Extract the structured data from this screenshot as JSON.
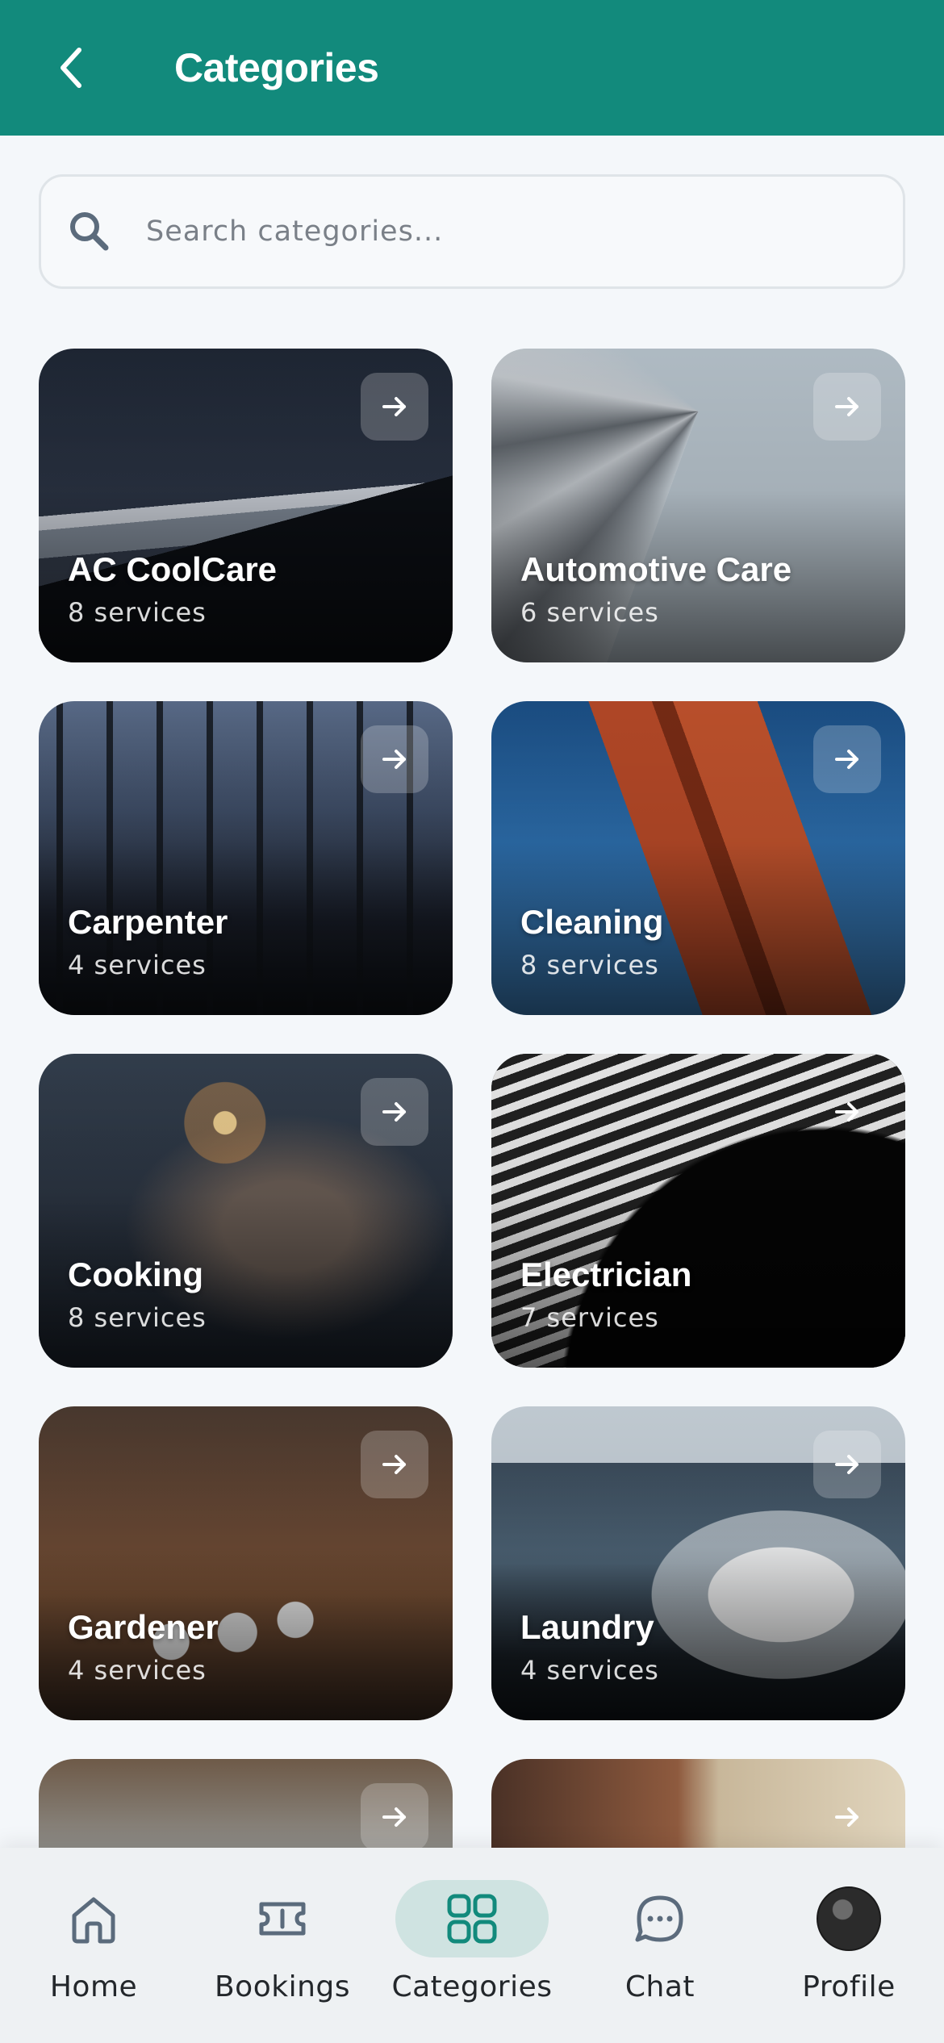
{
  "header": {
    "title": "Categories"
  },
  "search": {
    "placeholder": "Search categories..."
  },
  "categories": [
    {
      "name": "AC CoolCare",
      "count": "8 services"
    },
    {
      "name": "Automotive Care",
      "count": "6 services"
    },
    {
      "name": "Carpenter",
      "count": "4 services"
    },
    {
      "name": "Cleaning",
      "count": "8 services"
    },
    {
      "name": "Cooking",
      "count": "8 services"
    },
    {
      "name": "Electrician",
      "count": "7 services"
    },
    {
      "name": "Gardener",
      "count": "4 services"
    },
    {
      "name": "Laundry",
      "count": "4 services"
    }
  ],
  "bottom_nav": {
    "items": [
      {
        "label": "Home",
        "icon": "home-icon"
      },
      {
        "label": "Bookings",
        "icon": "ticket-icon"
      },
      {
        "label": "Categories",
        "icon": "grid-icon",
        "active": true
      },
      {
        "label": "Chat",
        "icon": "chat-bubble-icon"
      },
      {
        "label": "Profile",
        "icon": "avatar"
      }
    ]
  },
  "colors": {
    "primary": "#128a7c",
    "active_nav_bg": "#cfe3e1",
    "background": "#f4f7fa"
  }
}
